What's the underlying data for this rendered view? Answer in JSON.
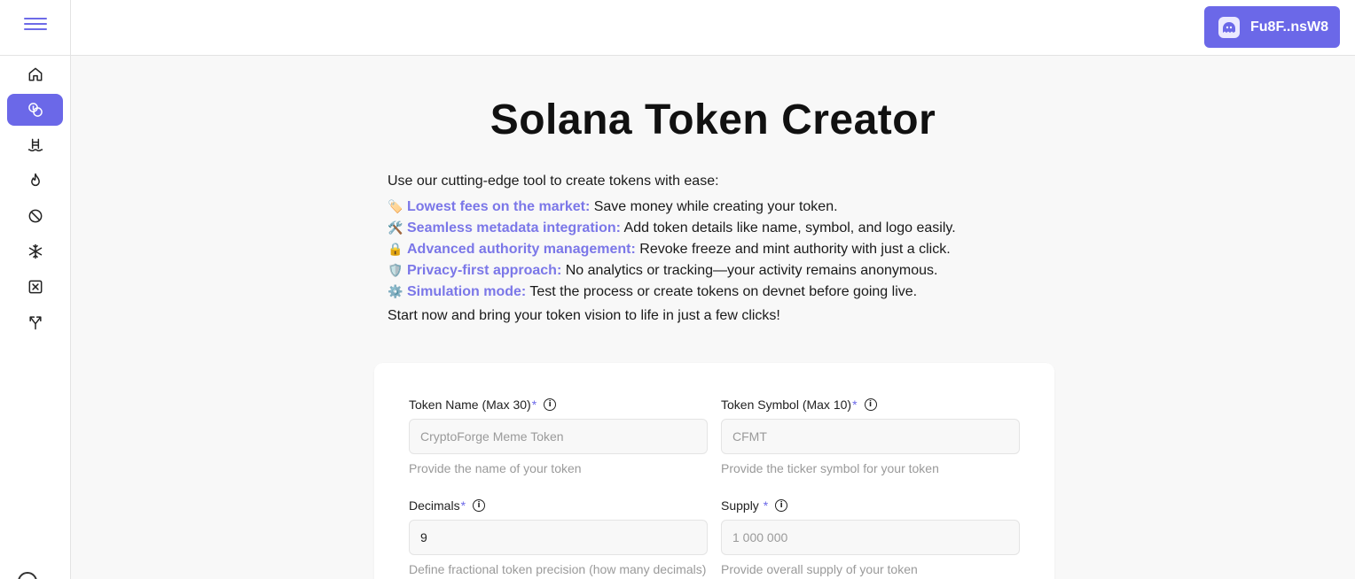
{
  "sidebar": {
    "menu_icon": "hamburger-icon",
    "items": [
      {
        "icon": "home-icon"
      },
      {
        "icon": "coins-icon",
        "active": true
      },
      {
        "icon": "pool-icon"
      },
      {
        "icon": "flame-icon"
      },
      {
        "icon": "ban-icon"
      },
      {
        "icon": "snowflake-icon"
      },
      {
        "icon": "box-x-icon"
      },
      {
        "icon": "split-icon"
      }
    ]
  },
  "header": {
    "wallet_label": "Fu8F..nsW8",
    "wallet_icon": "phantom-ghost-icon"
  },
  "main": {
    "title": "Solana Token Creator",
    "intro": "Use our cutting-edge tool to create tokens with ease:",
    "features": [
      {
        "emoji": "🏷️",
        "title": "Lowest fees on the market:",
        "text": " Save money while creating your token."
      },
      {
        "emoji": "🛠️",
        "title": "Seamless metadata integration:",
        "text": " Add token details like name, symbol, and logo easily."
      },
      {
        "emoji": "🔒",
        "title": "Advanced authority management:",
        "text": " Revoke freeze and mint authority with just a click."
      },
      {
        "emoji": "🛡️",
        "title": "Privacy-first approach:",
        "text": " No analytics or tracking—your activity remains anonymous."
      },
      {
        "emoji": "⚙️",
        "title": "Simulation mode:",
        "text": " Test the process or create tokens on devnet before going live."
      }
    ],
    "outro": "Start now and bring your token vision to life in just a few clicks!"
  },
  "form": {
    "token_name": {
      "label": "Token Name (Max 30)",
      "required_mark": "*",
      "placeholder": "CryptoForge Meme Token",
      "value": "",
      "hint": "Provide the name of your token"
    },
    "token_symbol": {
      "label": "Token Symbol (Max 10)",
      "required_mark": "*",
      "placeholder": "CFMT",
      "value": "",
      "hint": "Provide the ticker symbol for your token"
    },
    "decimals": {
      "label": "Decimals",
      "required_mark": "*",
      "placeholder": "",
      "value": "9",
      "hint": "Define fractional token precision (how many decimals)"
    },
    "supply": {
      "label": "Supply ",
      "required_mark": "*",
      "placeholder": "1 000 000",
      "value": "",
      "hint": "Provide overall supply of your token"
    }
  },
  "colors": {
    "accent": "#6b68e8",
    "feature_title": "#7b77e8",
    "background": "#f8f8f8"
  }
}
